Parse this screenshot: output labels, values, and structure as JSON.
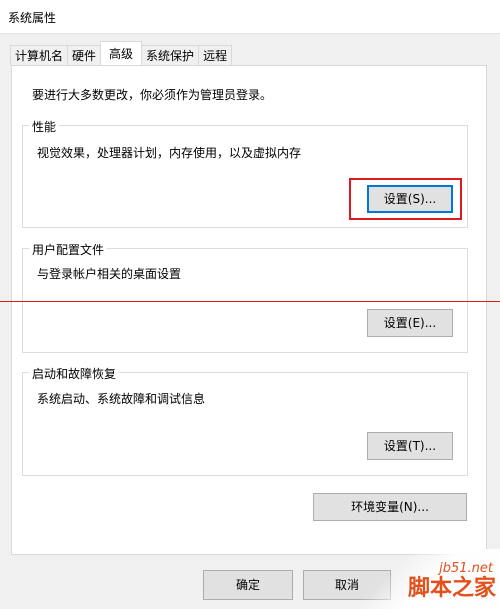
{
  "window": {
    "title": "系统属性"
  },
  "tabs": [
    {
      "label": "计算机名",
      "active": false
    },
    {
      "label": "硬件",
      "active": false
    },
    {
      "label": "高级",
      "active": true
    },
    {
      "label": "系统保护",
      "active": false
    },
    {
      "label": "远程",
      "active": false
    }
  ],
  "advanced": {
    "admin_note": "要进行大多数更改，你必须作为管理员登录。",
    "performance": {
      "title": "性能",
      "description": "视觉效果，处理器计划，内存使用，以及虚拟内存",
      "button": "设置(S)..."
    },
    "user_profiles": {
      "title": "用户配置文件",
      "description": "与登录帐户相关的桌面设置",
      "button": "设置(E)..."
    },
    "startup_recovery": {
      "title": "启动和故障恢复",
      "description": "系统启动、系统故障和调试信息",
      "button": "设置(T)..."
    },
    "env_button": "环境变量(N)..."
  },
  "footer": {
    "ok": "确定",
    "cancel": "取消"
  },
  "watermark": {
    "site": "jb51.net",
    "brand": "脚本之家"
  },
  "colors": {
    "highlight": "#e0191b",
    "focus": "#0078d7",
    "watermark": "#e2501c"
  }
}
